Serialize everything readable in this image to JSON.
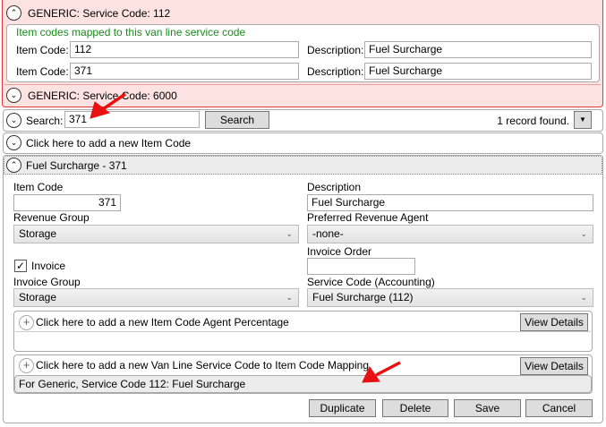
{
  "generic_112": {
    "header": "GENERIC: Service Code: 112",
    "note": "Item codes mapped to this van line service code",
    "rows": [
      {
        "item_label": "Item Code:",
        "item_value": "112",
        "desc_label": "Description:",
        "desc_value": "Fuel Surcharge"
      },
      {
        "item_label": "Item Code:",
        "item_value": "371",
        "desc_label": "Description:",
        "desc_value": "Fuel Surcharge"
      }
    ]
  },
  "generic_6000": {
    "header": "GENERIC: Service Code: 6000"
  },
  "search": {
    "label": "Search:",
    "value": "371",
    "button": "Search",
    "status": "1 record found."
  },
  "add_item": {
    "label": "Click here to add a new Item Code"
  },
  "detail": {
    "header": "Fuel Surcharge - 371",
    "item_code_label": "Item Code",
    "item_code": "371",
    "description_label": "Description",
    "description": "Fuel Surcharge",
    "revenue_group_label": "Revenue Group",
    "revenue_group": "Storage",
    "preferred_agent_label": "Preferred Revenue Agent",
    "preferred_agent": "-none-",
    "invoice_order_label": "Invoice Order",
    "invoice_order": "",
    "invoice_label": "Invoice",
    "invoice_checked": true,
    "invoice_group_label": "Invoice Group",
    "invoice_group": "Storage",
    "service_code_label": "Service Code (Accounting)",
    "service_code": "Fuel Surcharge (112)",
    "agent_pct": {
      "label": "Click here to add a new Item Code Agent Percentage",
      "view": "View Details"
    },
    "vanline": {
      "label": "Click here to add a new Van Line Service Code to Item Code Mapping",
      "view": "View Details",
      "items": [
        "For Generic, Service Code 112: Fuel Surcharge"
      ]
    },
    "buttons": {
      "duplicate": "Duplicate",
      "delete": "Delete",
      "save": "Save",
      "cancel": "Cancel"
    }
  },
  "colors": {
    "pink": "#fde2e2",
    "red_border": "#e03a3a",
    "green_text": "#1a8a1a",
    "arrow": "#e81010"
  }
}
